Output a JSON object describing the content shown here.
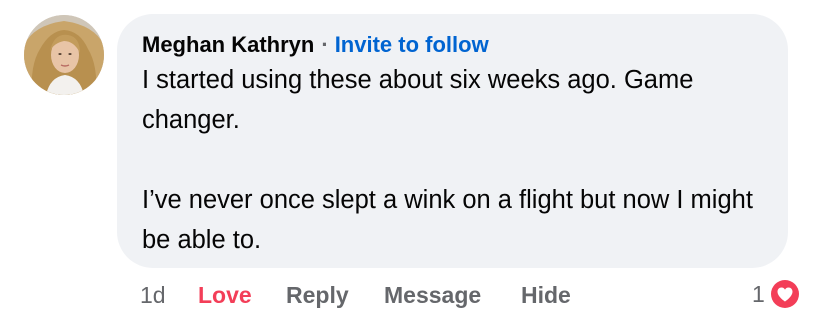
{
  "comment": {
    "author": "Meghan Kathryn",
    "separator": "·",
    "follow_link": "Invite to follow",
    "paragraphs": [
      "I started using these about six weeks ago. Game changer.",
      "I’ve never once slept a wink on a flight but now I might be able to."
    ],
    "avatar_icon": "profile-photo"
  },
  "actions": {
    "time": "1d",
    "love": "Love",
    "reply": "Reply",
    "message": "Message",
    "hide": "Hide"
  },
  "reactions": {
    "count": "1",
    "icon": "heart-icon"
  },
  "colors": {
    "bubble_bg": "#f0f2f5",
    "link_blue": "#0064d1",
    "love_red": "#f33e58",
    "muted_gray": "#65676b"
  }
}
